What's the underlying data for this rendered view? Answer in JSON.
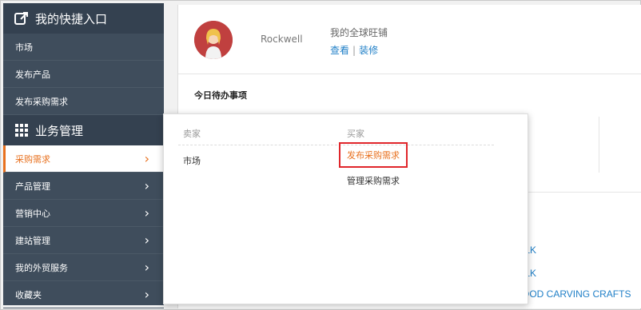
{
  "sidebar": {
    "quick_title": "我的快捷入口",
    "quick_links": [
      "市场",
      "发布产品",
      "发布采购需求"
    ],
    "biz_title": "业务管理",
    "biz_items": [
      {
        "label": "采购需求",
        "active": true
      },
      {
        "label": "产品管理",
        "active": false
      },
      {
        "label": "营销中心",
        "active": false
      },
      {
        "label": "建站管理",
        "active": false
      },
      {
        "label": "我的外贸服务",
        "active": false
      },
      {
        "label": "收藏夹",
        "active": false
      }
    ],
    "chevron": "›"
  },
  "main": {
    "user_name": "Rockwell",
    "store_title": "我的全球旺铺",
    "view_link": "查看",
    "separator": "|",
    "decorate_link": "装修",
    "todo_title": "今日待办事项",
    "links": [
      "ILK",
      "ILK",
      "OOD CARVING CRAFTS"
    ]
  },
  "flyout": {
    "seller_header": "卖家",
    "buyer_header": "买家",
    "seller_items": [
      "市场"
    ],
    "buyer_items": [
      "发布采购需求",
      "管理采购需求"
    ]
  },
  "colors": {
    "sidebar_bg": "#3f4d5c",
    "accent": "#e8711f",
    "link": "#1f7fc7",
    "highlight_border": "#e0262b"
  }
}
